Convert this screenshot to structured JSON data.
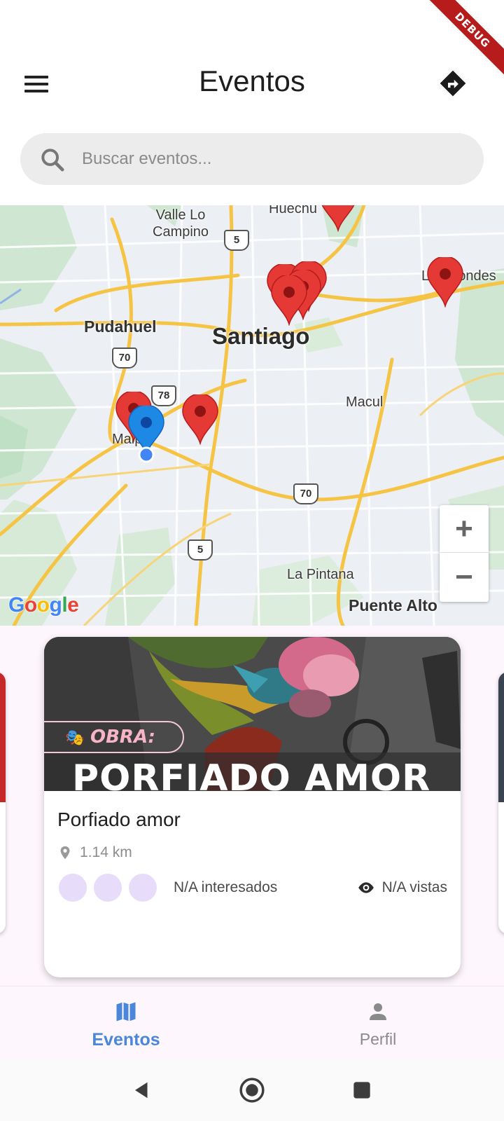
{
  "app_bar": {
    "title": "Eventos"
  },
  "debug_banner": "DEBUG",
  "search": {
    "placeholder": "Buscar eventos..."
  },
  "map": {
    "labels": {
      "valle_lo_campino": "Valle Lo\nCampino",
      "huechuraba": "Huechu",
      "las_condes": "Las Condes",
      "pudahuel": "Pudahuel",
      "santiago": "Santiago",
      "macul": "Macul",
      "maipu": "Maipú",
      "la_pintana": "La Pintana",
      "puente_alto": "Puente Alto"
    },
    "route_shields": [
      "5",
      "70",
      "78",
      "70",
      "5"
    ],
    "zoom_in": "+",
    "zoom_out": "−",
    "attribution": "Google",
    "marker_color": "#e53935",
    "user_marker_color": "#1e88e5"
  },
  "event_card": {
    "poster_tag": "OBRA:",
    "poster_headline": "PORFIADO AMOR",
    "title": "Porfiado amor",
    "distance": "1.14 km",
    "interested": "N/A interesados",
    "views": "N/A vistas"
  },
  "bottom_nav": {
    "items": [
      {
        "label": "Eventos",
        "icon": "map-icon",
        "active": true
      },
      {
        "label": "Perfil",
        "icon": "person-icon",
        "active": false
      }
    ],
    "active_color": "#4a86d9"
  }
}
